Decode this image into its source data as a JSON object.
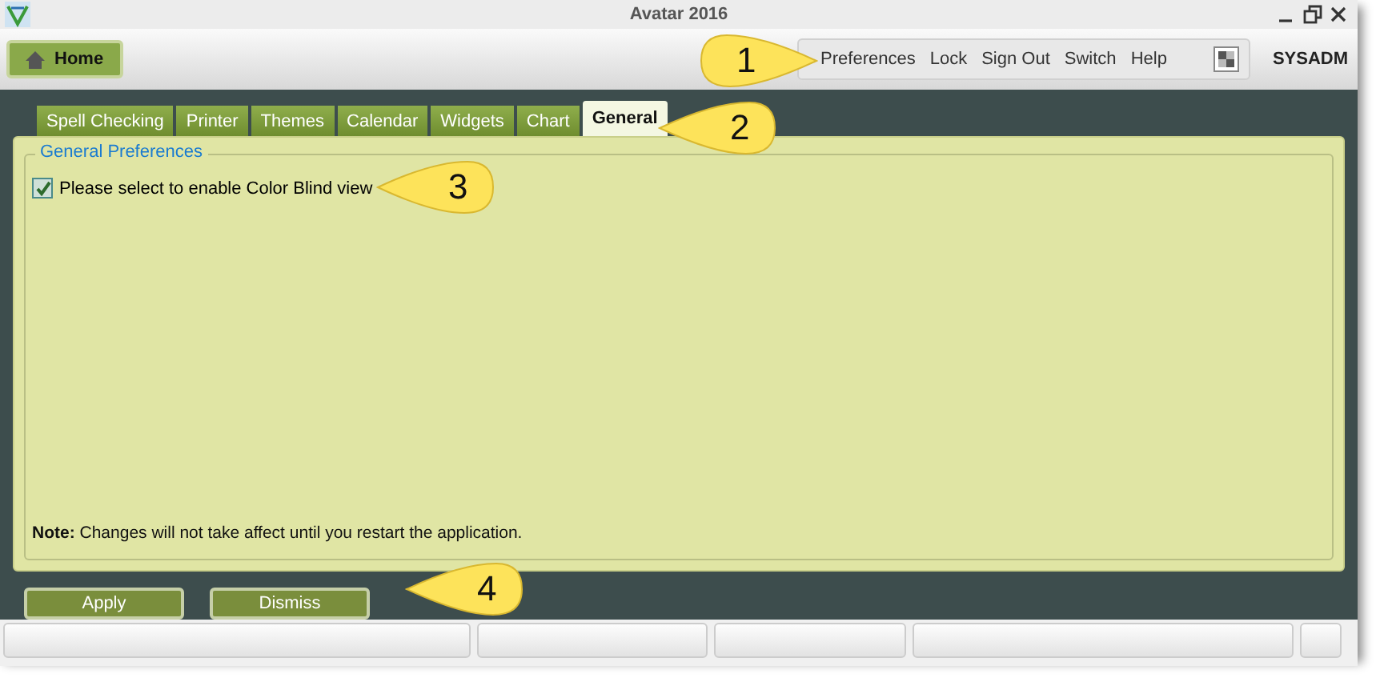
{
  "window": {
    "title": "Avatar 2016"
  },
  "home_button": {
    "label": "Home"
  },
  "header_links": [
    "Preferences",
    "Lock",
    "Sign Out",
    "Switch",
    "Help"
  ],
  "user": "SYSADM",
  "tabs": [
    {
      "label": "Spell Checking",
      "selected": false
    },
    {
      "label": "Printer",
      "selected": false
    },
    {
      "label": "Themes",
      "selected": false
    },
    {
      "label": "Calendar",
      "selected": false
    },
    {
      "label": "Widgets",
      "selected": false
    },
    {
      "label": "Chart",
      "selected": false
    },
    {
      "label": "General",
      "selected": true
    }
  ],
  "group": {
    "title": "General Preferences",
    "option": {
      "label": "Please select to enable Color Blind view",
      "checked": true
    }
  },
  "note": "**Note:** Changes will not take affect until you restart the application.",
  "buttons": [
    "Apply",
    "Dismiss"
  ],
  "callouts": [
    {
      "text": "1",
      "kind": "right"
    },
    {
      "text": "2",
      "kind": "left"
    },
    {
      "text": "3",
      "kind": "left"
    },
    {
      "text": "4",
      "kind": "left"
    }
  ]
}
